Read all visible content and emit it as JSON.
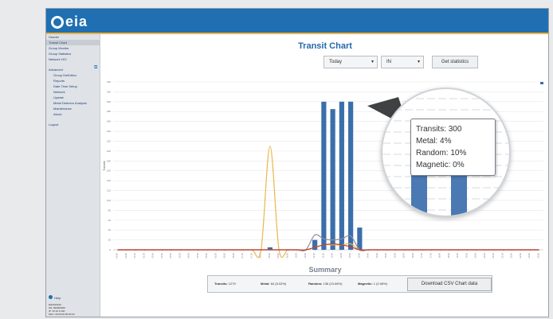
{
  "app": {
    "logo_text": "eia"
  },
  "sidebar": {
    "items": [
      {
        "label": "Header",
        "sub": false,
        "selected": false
      },
      {
        "label": "Transit Chart",
        "sub": false,
        "selected": true
      },
      {
        "label": "Group Monitor",
        "sub": false,
        "selected": false
      },
      {
        "label": "Group Statistics",
        "sub": false,
        "selected": false
      },
      {
        "label": "Network HCI",
        "sub": false,
        "selected": false
      },
      {
        "label": "Advanced",
        "sub": false,
        "selected": false
      },
      {
        "label": "Group Definition",
        "sub": true,
        "selected": false
      },
      {
        "label": "Reports",
        "sub": true,
        "selected": false
      },
      {
        "label": "Date Time Setup",
        "sub": true,
        "selected": false
      },
      {
        "label": "Network",
        "sub": true,
        "selected": false
      },
      {
        "label": "Update",
        "sub": true,
        "selected": false
      },
      {
        "label": "Metal Detector Analysis",
        "sub": true,
        "selected": false
      },
      {
        "label": "Maintenance",
        "sub": true,
        "selected": false
      },
      {
        "label": "About",
        "sub": true,
        "selected": false
      },
      {
        "label": "Logout",
        "sub": false,
        "selected": false
      }
    ],
    "help_label": "Help",
    "info_lines": [
      "EN0100100",
      "SN: 000000000",
      "IP: 10.10.0.100",
      "MAC: 00:00:00:00:00:00"
    ]
  },
  "main": {
    "title": "Transit Chart",
    "period_select": "Today",
    "direction_select": "IN",
    "get_stats_button": "Get statistics",
    "summary_title": "Summary",
    "summary": {
      "transits_label": "Transits:",
      "transits_value": "1279",
      "metal_label": "Metal:",
      "metal_value": "64 (5.02%)",
      "random_label": "Random:",
      "random_value": "136 (10.66%)",
      "magnetic_label": "Magnetic:",
      "magnetic_value": "1 (0.08%)"
    },
    "download_button": "Download CSV Chart data"
  },
  "tooltip_small": {
    "lines": [
      "Transits: 300",
      "Metal: 4%",
      "Random: 10%",
      "Magnetic: 0%"
    ]
  },
  "tooltip": {
    "lines": [
      "Transits: 300",
      "Metal: 4%",
      "Random: 10%",
      "Magnetic: 0%"
    ]
  },
  "colors": {
    "header": "#1f6fb2",
    "accent": "#f0b33b",
    "bar": "#3b6fab",
    "metal": "#e8b84a",
    "random": "#8a8f96",
    "magnetic": "#c0392b"
  },
  "chart_data": {
    "type": "bar",
    "title": "",
    "ylabel": "Transits",
    "ylim": [
      0,
      340
    ],
    "yticks": [
      0,
      20,
      40,
      60,
      80,
      100,
      120,
      140,
      160,
      180,
      200,
      220,
      240,
      260,
      280,
      300,
      320,
      340
    ],
    "x": [
      "00:00",
      "00:30",
      "01:00",
      "01:30",
      "02:00",
      "02:30",
      "03:00",
      "03:30",
      "04:00",
      "04:30",
      "05:00",
      "05:30",
      "06:00",
      "06:30",
      "07:00",
      "07:30",
      "08:00",
      "08:30",
      "09:00",
      "09:30",
      "10:00",
      "10:30",
      "11:00",
      "11:30",
      "12:00",
      "12:30",
      "13:00",
      "13:30",
      "14:00",
      "14:30",
      "15:00",
      "15:30",
      "16:00",
      "16:30",
      "17:00",
      "17:30",
      "18:00",
      "18:30",
      "19:00",
      "19:30",
      "20:00",
      "20:30",
      "21:00",
      "21:30",
      "22:00",
      "22:30",
      "23:00",
      "23:30"
    ],
    "series": [
      {
        "name": "Transits",
        "kind": "bar",
        "values": [
          0,
          0,
          0,
          0,
          0,
          0,
          0,
          0,
          0,
          0,
          0,
          0,
          0,
          0,
          0,
          0,
          0,
          5,
          0,
          0,
          0,
          0,
          20,
          300,
          285,
          300,
          300,
          45,
          0,
          0,
          0,
          0,
          0,
          0,
          0,
          0,
          0,
          0,
          0,
          0,
          0,
          0,
          0,
          0,
          0,
          0,
          0,
          0
        ]
      },
      {
        "name": "Metal",
        "kind": "line",
        "values": [
          0,
          0,
          0,
          0,
          0,
          0,
          0,
          0,
          0,
          0,
          0,
          0,
          0,
          0,
          0,
          0,
          0,
          210,
          0,
          0,
          0,
          0,
          5,
          10,
          10,
          10,
          12,
          0,
          0,
          0,
          0,
          0,
          0,
          0,
          0,
          0,
          0,
          0,
          0,
          0,
          0,
          0,
          0,
          0,
          0,
          0,
          0,
          0
        ]
      },
      {
        "name": "Random",
        "kind": "line",
        "values": [
          0,
          0,
          0,
          0,
          0,
          0,
          0,
          0,
          0,
          0,
          0,
          0,
          0,
          0,
          0,
          0,
          0,
          0,
          0,
          0,
          0,
          0,
          30,
          22,
          20,
          22,
          28,
          0,
          0,
          0,
          0,
          0,
          0,
          0,
          0,
          0,
          0,
          0,
          0,
          0,
          0,
          0,
          0,
          0,
          0,
          0,
          0,
          0
        ]
      },
      {
        "name": "Magnetic",
        "kind": "line",
        "values": [
          0,
          0,
          0,
          0,
          0,
          0,
          0,
          0,
          0,
          0,
          0,
          0,
          0,
          0,
          0,
          0,
          0,
          0,
          0,
          0,
          0,
          0,
          5,
          10,
          12,
          10,
          6,
          0,
          0,
          0,
          0,
          0,
          0,
          0,
          0,
          0,
          0,
          0,
          0,
          0,
          0,
          0,
          0,
          0,
          0,
          0,
          0,
          0
        ]
      }
    ],
    "grid": true,
    "legend": "top-right"
  }
}
